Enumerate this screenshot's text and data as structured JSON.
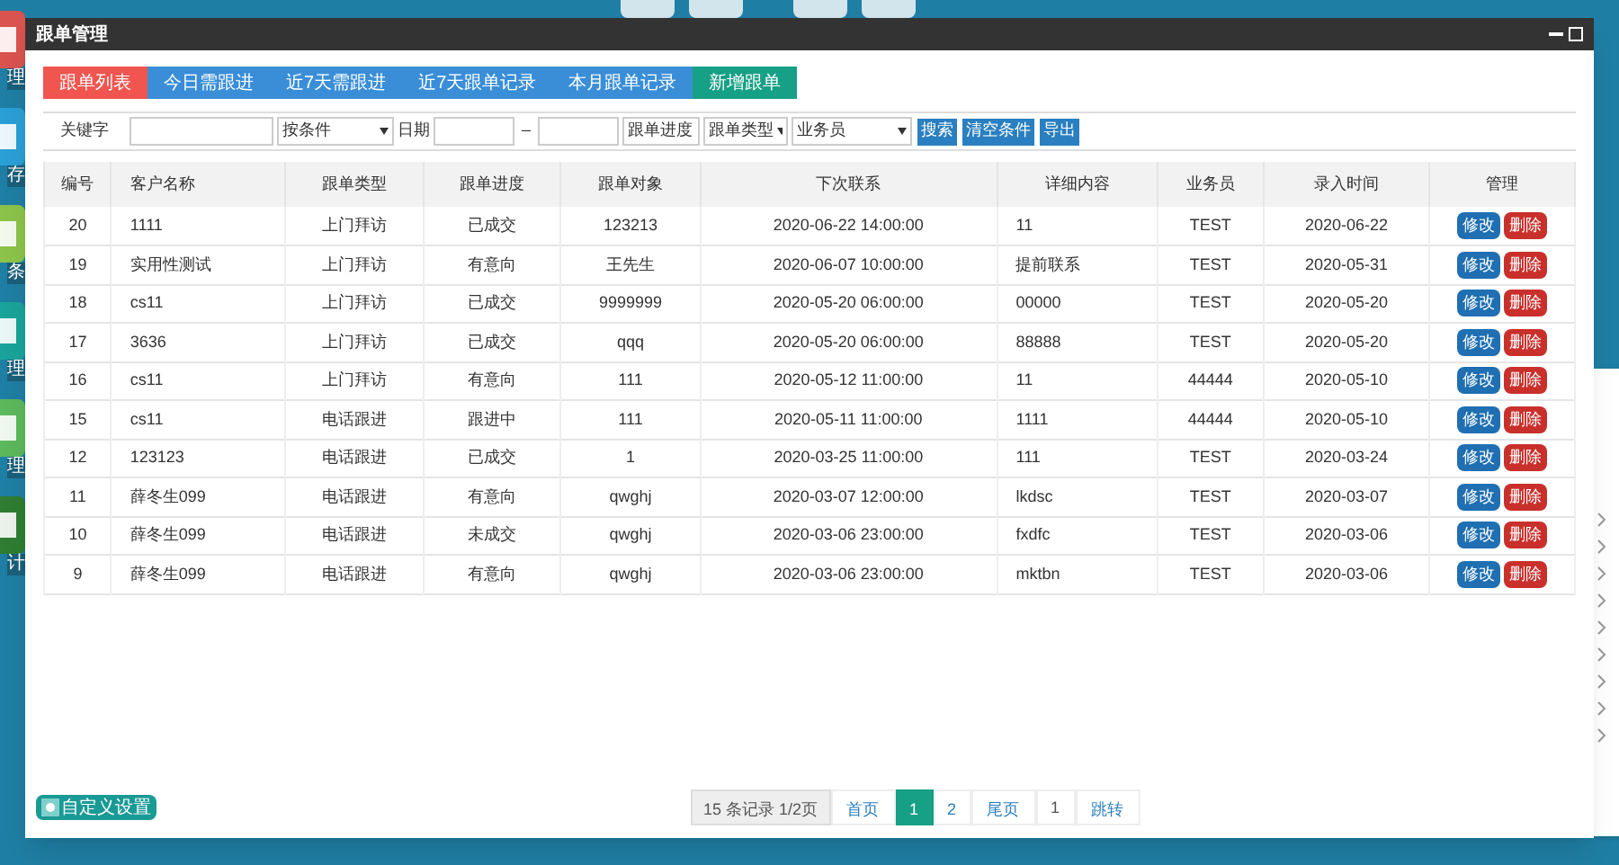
{
  "desktop_icons": [
    {
      "label": "理"
    },
    {
      "label": "存"
    },
    {
      "label": "条"
    },
    {
      "label": "理"
    },
    {
      "label": "理"
    },
    {
      "label": "计"
    }
  ],
  "window": {
    "title": "跟单管理"
  },
  "tabs": [
    {
      "label": "跟单列表",
      "selected": true
    },
    {
      "label": "今日需跟进",
      "selected": false
    },
    {
      "label": "近7天需跟进",
      "selected": false
    },
    {
      "label": "近7天跟单记录",
      "selected": false
    },
    {
      "label": "本月跟单记录",
      "selected": false
    }
  ],
  "add_button": "新增跟单",
  "filters": {
    "keyword_label": "关键字",
    "condition": "按条件",
    "date_label": "日期",
    "date_separator": "–",
    "progress": "跟单进度",
    "type": "跟单类型",
    "salesperson": "业务员",
    "buttons": [
      "搜索",
      "清空条件",
      "导出"
    ]
  },
  "table": {
    "columns": [
      "编号",
      "客户名称",
      "跟单类型",
      "跟单进度",
      "跟单对象",
      "下次联系",
      "详细内容",
      "业务员",
      "录入时间",
      "管理"
    ],
    "rows": [
      {
        "cells": [
          "20",
          "1111",
          "上门拜访",
          "已成交",
          "123213",
          "2020-06-22 14:00:00",
          "11",
          "TEST",
          "2020-06-22"
        ],
        "actions": [
          "修改",
          "删除"
        ]
      },
      {
        "cells": [
          "19",
          "实用性测试",
          "上门拜访",
          "有意向",
          "王先生",
          "2020-06-07 10:00:00",
          "提前联系",
          "TEST",
          "2020-05-31"
        ],
        "actions": [
          "修改",
          "删除"
        ]
      },
      {
        "cells": [
          "18",
          "cs11",
          "上门拜访",
          "已成交",
          "9999999",
          "2020-05-20 06:00:00",
          "00000",
          "TEST",
          "2020-05-20"
        ],
        "actions": [
          "修改",
          "删除"
        ]
      },
      {
        "cells": [
          "17",
          "3636",
          "上门拜访",
          "已成交",
          "qqq",
          "2020-05-20 06:00:00",
          "88888",
          "TEST",
          "2020-05-20"
        ],
        "actions": [
          "修改",
          "删除"
        ]
      },
      {
        "cells": [
          "16",
          "cs11",
          "上门拜访",
          "有意向",
          "111",
          "2020-05-12 11:00:00",
          "11",
          "44444",
          "2020-05-10"
        ],
        "actions": [
          "修改",
          "删除"
        ]
      },
      {
        "cells": [
          "15",
          "cs11",
          "电话跟进",
          "跟进中",
          "111",
          "2020-05-11 11:00:00",
          "1111",
          "44444",
          "2020-05-10"
        ],
        "actions": [
          "修改",
          "删除"
        ]
      },
      {
        "cells": [
          "12",
          "123123",
          "电话跟进",
          "已成交",
          "1",
          "2020-03-25 11:00:00",
          "111",
          "TEST",
          "2020-03-24"
        ],
        "actions": [
          "修改",
          "删除"
        ]
      },
      {
        "cells": [
          "11",
          "薛冬生099",
          "电话跟进",
          "有意向",
          "qwghj",
          "2020-03-07 12:00:00",
          "lkdsc",
          "TEST",
          "2020-03-07"
        ],
        "actions": [
          "修改",
          "删除"
        ]
      },
      {
        "cells": [
          "10",
          "薛冬生099",
          "电话跟进",
          "未成交",
          "qwghj",
          "2020-03-06 23:00:00",
          "fxdfc",
          "TEST",
          "2020-03-06"
        ],
        "actions": [
          "修改",
          "删除"
        ]
      },
      {
        "cells": [
          "9",
          "薛冬生099",
          "电话跟进",
          "有意向",
          "qwghj",
          "2020-03-06 23:00:00",
          "mktbn",
          "TEST",
          "2020-03-06"
        ],
        "actions": [
          "修改",
          "删除"
        ]
      }
    ]
  },
  "footer": {
    "custom_button": "自定义设置",
    "record_count": "15 条记录 1/2页",
    "first": "首页",
    "pages": [
      {
        "label": "1",
        "selected": true
      },
      {
        "label": "2",
        "selected": false
      }
    ],
    "last": "尾页",
    "jump_value": "1",
    "jump": "跳转"
  }
}
